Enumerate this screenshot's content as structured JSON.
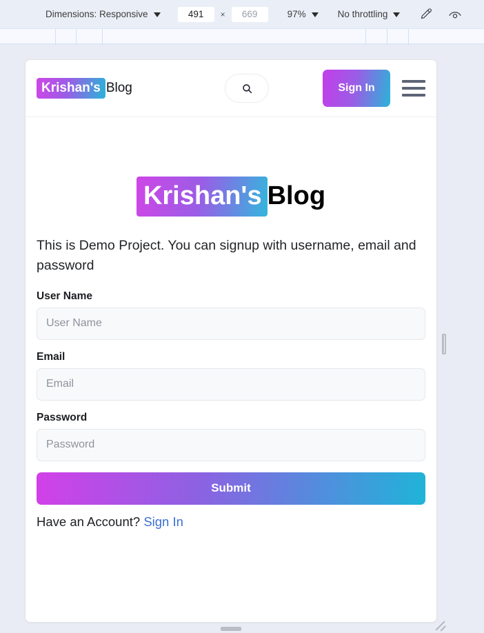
{
  "devtools_toolbar": {
    "dimensions_label": "Dimensions: Responsive",
    "width_value": "491",
    "height_value": "669",
    "size_separator": "×",
    "zoom_level": "97%",
    "throttling": "No throttling",
    "eyedropper_icon": "eyedropper-icon",
    "cast_icon": "cast-icon",
    "caret_icon": "chevron-down-icon"
  },
  "navbar": {
    "brand_badge": "Krishan's",
    "brand_rest": "Blog",
    "search_icon": "search-icon",
    "signin_label": "Sign In",
    "menu_icon": "hamburger-menu-icon"
  },
  "hero": {
    "badge": "Krishan's",
    "rest": "Blog",
    "intro": "This is Demo Project. You can signup with username, email and password"
  },
  "form": {
    "fields": [
      {
        "label": "User Name",
        "placeholder": "User Name",
        "value": ""
      },
      {
        "label": "Email",
        "placeholder": "Email",
        "value": ""
      },
      {
        "label": "Password",
        "placeholder": "Password",
        "value": ""
      }
    ],
    "submit_label": "Submit",
    "account_prompt": "Have an Account? ",
    "account_link": "Sign In"
  },
  "colors": {
    "gradient_start": "#cf46e6",
    "gradient_mid": "#9a5de6",
    "gradient_end": "#2ab4d8",
    "link_blue": "#3b6fd4",
    "toolbar_bg": "#eaeff7",
    "page_bg": "#e9ecf4",
    "input_bg": "#f8f9fb"
  }
}
